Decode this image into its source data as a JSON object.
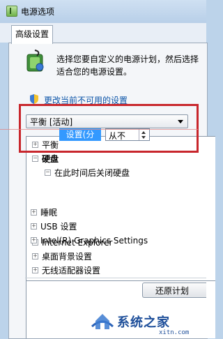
{
  "window": {
    "title": "电源选项"
  },
  "tabs": [
    {
      "label": "高级设置"
    }
  ],
  "intro": {
    "description": "选择您要自定义的电源计划，然后选择适合您的电源设置。",
    "change_link": "更改当前不可用的设置"
  },
  "plan_select": {
    "value": "平衡 [活动]"
  },
  "tree": {
    "items": [
      {
        "label": "平衡",
        "state": "collapsed"
      },
      {
        "label": "硬盘",
        "state": "expanded",
        "bold": true
      },
      {
        "label": "在此时间后关闭硬盘",
        "state": "expanded"
      },
      {
        "label": "Internet Explorer",
        "state": "collapsed"
      },
      {
        "label": "桌面背景设置",
        "state": "collapsed"
      },
      {
        "label": "无线适配器设置",
        "state": "collapsed"
      },
      {
        "label": "睡眠",
        "state": "collapsed"
      },
      {
        "label": "USB 设置",
        "state": "collapsed"
      },
      {
        "label": "Intel(R) Graphics Settings",
        "state": "collapsed"
      }
    ],
    "setting_label": "设置(分钟):",
    "setting_value": "从不"
  },
  "buttons": {
    "restore": "还原计划"
  },
  "watermark": {
    "text": "系统之家",
    "sub": "xitn.com"
  },
  "colors": {
    "highlight": "#3399ff",
    "annotation": "#c8262c",
    "link": "#0b54a8"
  }
}
